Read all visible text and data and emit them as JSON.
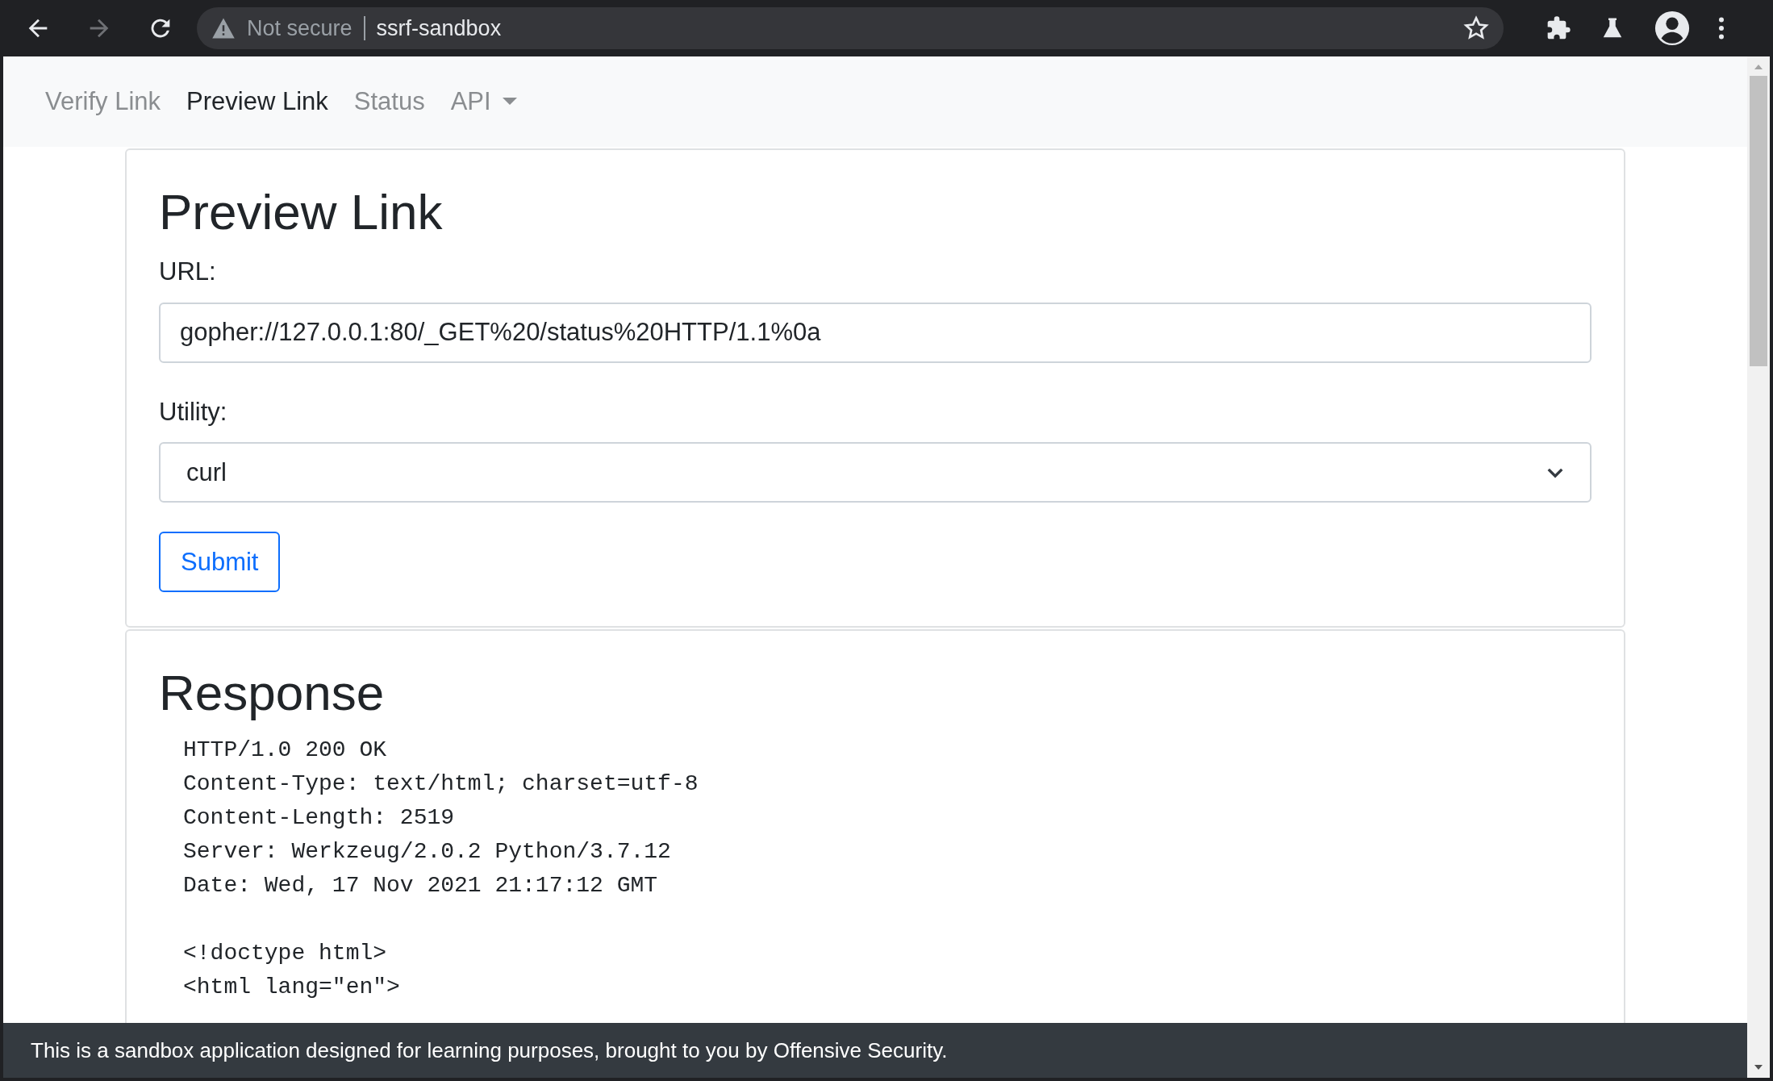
{
  "browser": {
    "back_enabled": true,
    "forward_enabled": false,
    "security": "Not secure",
    "address": "ssrf-sandbox"
  },
  "nav": [
    {
      "label": "Verify Link",
      "selected": false,
      "dropdown": false
    },
    {
      "label": "Preview Link",
      "selected": true,
      "dropdown": false
    },
    {
      "label": "Status",
      "selected": false,
      "dropdown": false
    },
    {
      "label": "API",
      "selected": false,
      "dropdown": true
    }
  ],
  "form": {
    "title": "Preview Link",
    "url_label": "URL:",
    "url_value": "gopher://127.0.0.1:80/_GET%20/status%20HTTP/1.1%0a",
    "utility_label": "Utility:",
    "utility_value": "curl",
    "submit": "Submit"
  },
  "response": {
    "title": "Response",
    "headers": [
      "HTTP/1.0 200 OK",
      "Content-Type: text/html; charset=utf-8",
      "Content-Length: 2519",
      "Server: Werkzeug/2.0.2 Python/3.7.12",
      "Date: Wed, 17 Nov 2021 21:17:12 GMT"
    ],
    "body": [
      "<!doctype html>",
      "<html lang=\"en\">"
    ]
  },
  "footer": "This is a sandbox application designed for learning purposes, brought to you by Offensive Security."
}
